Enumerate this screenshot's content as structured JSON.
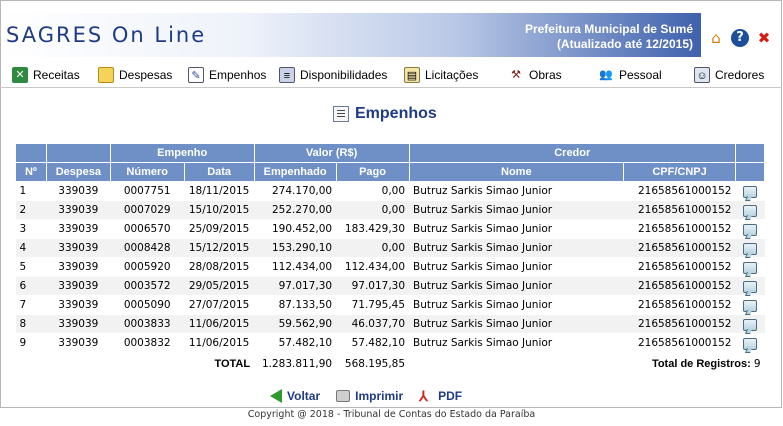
{
  "header": {
    "logo": "SAGRES On Line",
    "org": "Prefeitura Municipal de Sumé",
    "updated": "(Atualizado até 12/2015)",
    "icons": [
      "home-icon",
      "help-icon",
      "close-icon"
    ]
  },
  "menu": {
    "items": [
      {
        "label": "Receitas",
        "icon": "receitas-icon"
      },
      {
        "label": "Despesas",
        "icon": "despesas-icon"
      },
      {
        "label": "Empenhos",
        "icon": "empenhos-icon"
      },
      {
        "label": "Disponibilidades",
        "icon": "disponibilidades-icon"
      },
      {
        "label": "Licitações",
        "icon": "licitacoes-icon"
      },
      {
        "label": "Obras",
        "icon": "obras-icon"
      },
      {
        "label": "Pessoal",
        "icon": "pessoal-icon"
      },
      {
        "label": "Credores",
        "icon": "credores-icon"
      }
    ]
  },
  "page": {
    "title": "Empenhos"
  },
  "table": {
    "group_headers": {
      "empenho": "Empenho",
      "valor": "Valor (R$)",
      "credor": "Credor"
    },
    "columns": [
      "Nº",
      "Despesa",
      "Número",
      "Data",
      "Empenhado",
      "Pago",
      "Nome",
      "CPF/CNPJ"
    ],
    "rows": [
      {
        "n": "1",
        "despesa": "339039",
        "numero": "0007751",
        "data": "18/11/2015",
        "empenhado": "274.170,00",
        "pago": "0,00",
        "nome": "Butruz Sarkis Simao Junior",
        "cpf": "21658561000152"
      },
      {
        "n": "2",
        "despesa": "339039",
        "numero": "0007029",
        "data": "15/10/2015",
        "empenhado": "252.270,00",
        "pago": "0,00",
        "nome": "Butruz Sarkis Simao Junior",
        "cpf": "21658561000152"
      },
      {
        "n": "3",
        "despesa": "339039",
        "numero": "0006570",
        "data": "25/09/2015",
        "empenhado": "190.452,00",
        "pago": "183.429,30",
        "nome": "Butruz Sarkis Simao Junior",
        "cpf": "21658561000152"
      },
      {
        "n": "4",
        "despesa": "339039",
        "numero": "0008428",
        "data": "15/12/2015",
        "empenhado": "153.290,10",
        "pago": "0,00",
        "nome": "Butruz Sarkis Simao Junior",
        "cpf": "21658561000152"
      },
      {
        "n": "5",
        "despesa": "339039",
        "numero": "0005920",
        "data": "28/08/2015",
        "empenhado": "112.434,00",
        "pago": "112.434,00",
        "nome": "Butruz Sarkis Simao Junior",
        "cpf": "21658561000152"
      },
      {
        "n": "6",
        "despesa": "339039",
        "numero": "0003572",
        "data": "29/05/2015",
        "empenhado": "97.017,30",
        "pago": "97.017,30",
        "nome": "Butruz Sarkis Simao Junior",
        "cpf": "21658561000152"
      },
      {
        "n": "7",
        "despesa": "339039",
        "numero": "0005090",
        "data": "27/07/2015",
        "empenhado": "87.133,50",
        "pago": "71.795,45",
        "nome": "Butruz Sarkis Simao Junior",
        "cpf": "21658561000152"
      },
      {
        "n": "8",
        "despesa": "339039",
        "numero": "0003833",
        "data": "11/06/2015",
        "empenhado": "59.562,90",
        "pago": "46.037,70",
        "nome": "Butruz Sarkis Simao Junior",
        "cpf": "21658561000152"
      },
      {
        "n": "9",
        "despesa": "339039",
        "numero": "0003832",
        "data": "11/06/2015",
        "empenhado": "57.482,10",
        "pago": "57.482,10",
        "nome": "Butruz Sarkis Simao Junior",
        "cpf": "21658561000152"
      }
    ],
    "total_label": "TOTAL",
    "total_empenhado": "1.283.811,90",
    "total_pago": "568.195,85",
    "total_registros_label": "Total de Registros:",
    "total_registros": "9"
  },
  "actions": {
    "voltar": "Voltar",
    "imprimir": "Imprimir",
    "pdf": "PDF"
  },
  "footer": {
    "copyright": "Copyright @ 2018 - Tribunal de Contas do Estado da Paraíba"
  },
  "colors": {
    "header_blue": "#1f3b86",
    "table_header": "#6f90c6",
    "row_alt": "#f2f2f2"
  }
}
